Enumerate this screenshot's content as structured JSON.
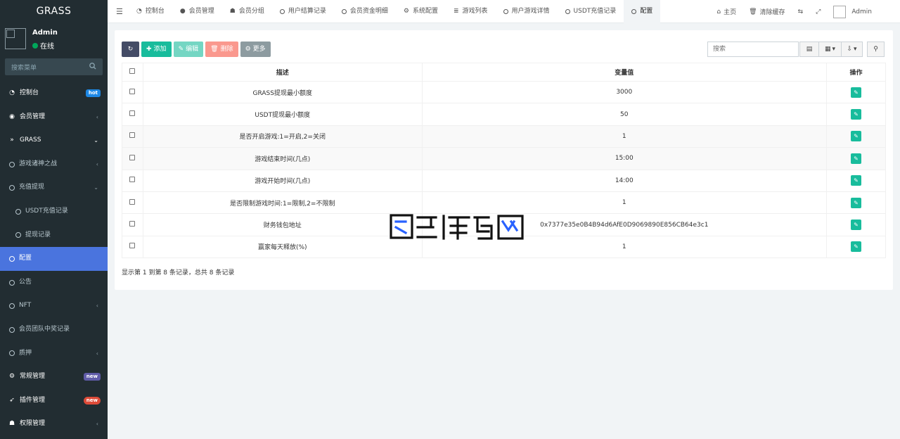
{
  "sidebar": {
    "logo": "GRASS",
    "user": {
      "name": "Admin",
      "status": "在线",
      "status_color": "#00a65a"
    },
    "search_placeholder": "搜索菜单",
    "items": [
      {
        "label": "控制台",
        "icon": "dashboard-icon",
        "badge": "hot"
      },
      {
        "label": "会员管理",
        "icon": "user-circle-icon"
      },
      {
        "label": "GRASS",
        "icon": "double-chevron-icon"
      },
      {
        "label": "游戏诸神之战",
        "icon": "circle-icon"
      },
      {
        "label": "充值提现",
        "icon": "circle-icon"
      },
      {
        "label": "USDT充值记录",
        "icon": "circle-icon"
      },
      {
        "label": "提现记录",
        "icon": "circle-icon"
      },
      {
        "label": "配置",
        "icon": "circle-icon"
      },
      {
        "label": "公告",
        "icon": "circle-icon"
      },
      {
        "label": "NFT",
        "icon": "circle-icon"
      },
      {
        "label": "会员团队中奖记录",
        "icon": "circle-icon"
      },
      {
        "label": "质押",
        "icon": "circle-icon"
      },
      {
        "label": "常规管理",
        "icon": "gears-icon",
        "badge": "new"
      },
      {
        "label": "插件管理",
        "icon": "rocket-icon",
        "badge": "new"
      },
      {
        "label": "权限管理",
        "icon": "users-icon"
      }
    ]
  },
  "topbar": {
    "tabs": [
      {
        "label": "控制台",
        "icon": "dashboard-icon"
      },
      {
        "label": "会员管理",
        "icon": "user-icon"
      },
      {
        "label": "会员分组",
        "icon": "users-icon"
      },
      {
        "label": "用户结算记录",
        "icon": "circle-icon"
      },
      {
        "label": "会员资金明细",
        "icon": "circle-icon"
      },
      {
        "label": "系统配置",
        "icon": "gear-icon"
      },
      {
        "label": "游戏列表",
        "icon": "list-icon"
      },
      {
        "label": "用户游戏详情",
        "icon": "circle-icon"
      },
      {
        "label": "USDT充值记录",
        "icon": "circle-icon"
      },
      {
        "label": "配置",
        "icon": "circle-icon"
      }
    ],
    "home": "主页",
    "clear_cache": "清除缓存",
    "admin": "Admin"
  },
  "toolbar": {
    "add": "添加",
    "edit": "编辑",
    "delete": "删除",
    "more": "更多",
    "search_placeholder": "搜索"
  },
  "table": {
    "headers": {
      "desc": "描述",
      "value": "变量值",
      "ops": "操作"
    },
    "rows": [
      {
        "desc": "GRASS提现最小额度",
        "value": "3000"
      },
      {
        "desc": "USDT提现最小额度",
        "value": "50"
      },
      {
        "desc": "是否开启游戏:1=开启,2=关闭",
        "value": "1"
      },
      {
        "desc": "游戏结束时间(几点)",
        "value": "15:00"
      },
      {
        "desc": "游戏开始时间(几点)",
        "value": "14:00"
      },
      {
        "desc": "是否限制游戏时间:1=限制,2=不限制",
        "value": "1"
      },
      {
        "desc": "财务钱包地址",
        "value": "0x7377e35e0B4B94d6AfE0D9069890E856CB64e3c1"
      },
      {
        "desc": "赢家每天释放(%)",
        "value": "1"
      }
    ]
  },
  "footer": "显示第 1 到第 8 条记录，总共 8 条记录",
  "colors": {
    "sidebar_bg": "#222d32",
    "active": "#4a74de",
    "success": "#18bc9c",
    "danger": "#f75444"
  }
}
